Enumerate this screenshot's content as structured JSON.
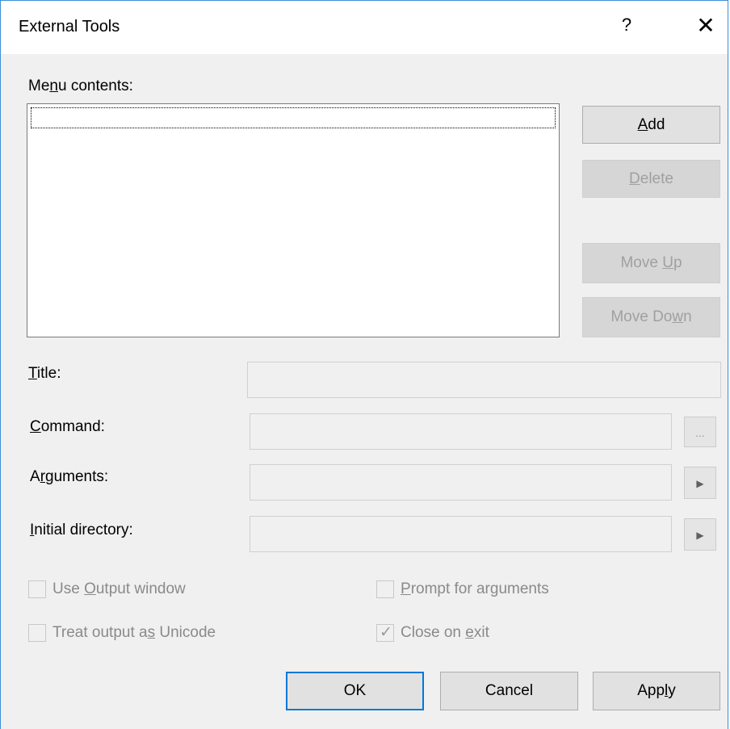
{
  "window": {
    "title": "External Tools",
    "help_glyph": "?",
    "close_glyph": "✕"
  },
  "menu_contents": {
    "label_pre": "Me",
    "label_u": "n",
    "label_post": "u contents:"
  },
  "side_buttons": {
    "add": {
      "u": "A",
      "rest": "dd"
    },
    "delete": {
      "u": "D",
      "rest": "elete"
    },
    "move_up": {
      "pre": "Move ",
      "u": "U",
      "rest": "p"
    },
    "move_down": {
      "pre": "Move Do",
      "u": "w",
      "rest": "n"
    }
  },
  "fields": {
    "title": {
      "u": "T",
      "rest": "itle:",
      "value": ""
    },
    "command": {
      "u": "C",
      "rest": "ommand:",
      "value": "",
      "browse_glyph": "..."
    },
    "arguments": {
      "pre": "A",
      "u": "r",
      "rest": "guments:",
      "value": "",
      "arrow_glyph": "▶"
    },
    "initial_directory": {
      "u": "I",
      "rest": "nitial directory:",
      "value": "",
      "arrow_glyph": "▶"
    }
  },
  "options": {
    "use_output": {
      "pre": "Use ",
      "u": "O",
      "rest": "utput window",
      "checked": false
    },
    "prompt_args": {
      "u": "P",
      "rest": "rompt for arguments",
      "checked": false
    },
    "treat_unicode": {
      "pre": "Treat output a",
      "u": "s",
      "rest": " Unicode",
      "checked": false
    },
    "close_on_exit": {
      "pre": "Close on ",
      "u": "e",
      "rest": "xit",
      "checked": true,
      "check_glyph": "✓"
    }
  },
  "footer": {
    "ok": "OK",
    "cancel": "Cancel",
    "apply_pre": "App",
    "apply_u": "l",
    "apply_post": "y"
  }
}
